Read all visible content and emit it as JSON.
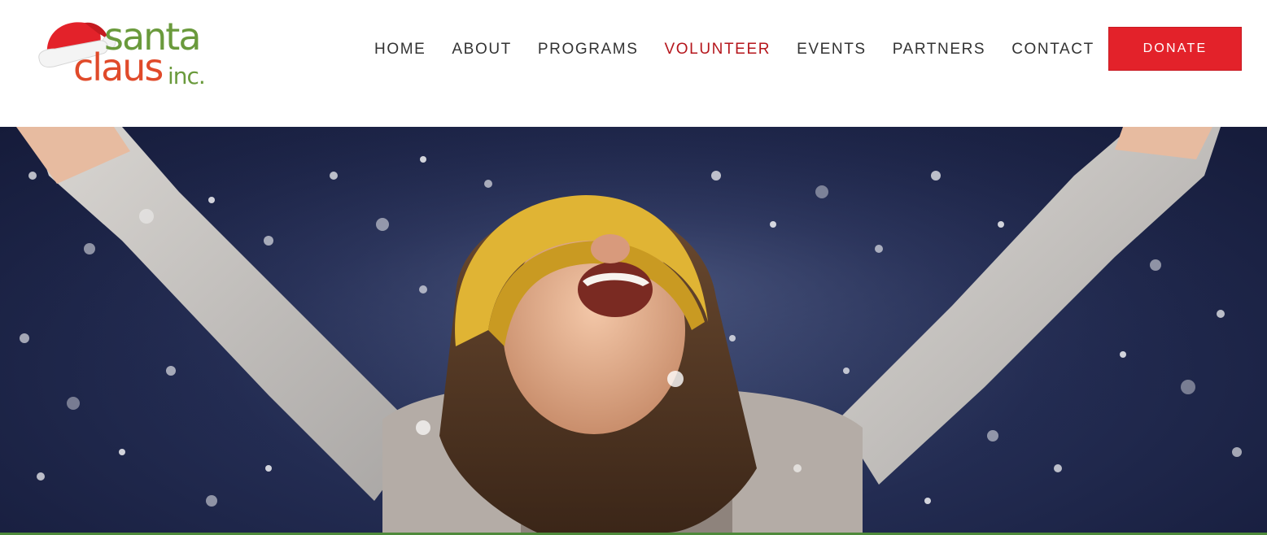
{
  "logo": {
    "line1": "santa",
    "line2": "claus",
    "line3": "inc.",
    "colors": {
      "green": "#6a9a3c",
      "red": "#e04a2a"
    },
    "icon": "santa-hat-icon"
  },
  "nav": {
    "items": [
      {
        "label": "HOME",
        "active": false
      },
      {
        "label": "ABOUT",
        "active": false
      },
      {
        "label": "PROGRAMS",
        "active": false
      },
      {
        "label": "VOLUNTEER",
        "active": true
      },
      {
        "label": "EVENTS",
        "active": false
      },
      {
        "label": "PARTNERS",
        "active": false
      },
      {
        "label": "CONTACT",
        "active": false
      }
    ],
    "active_color": "#b5161c"
  },
  "donate": {
    "label": "DONATE",
    "color": "#e3222a"
  },
  "hero": {
    "image": "child-in-snow-photo",
    "background_color": "#232c52"
  }
}
